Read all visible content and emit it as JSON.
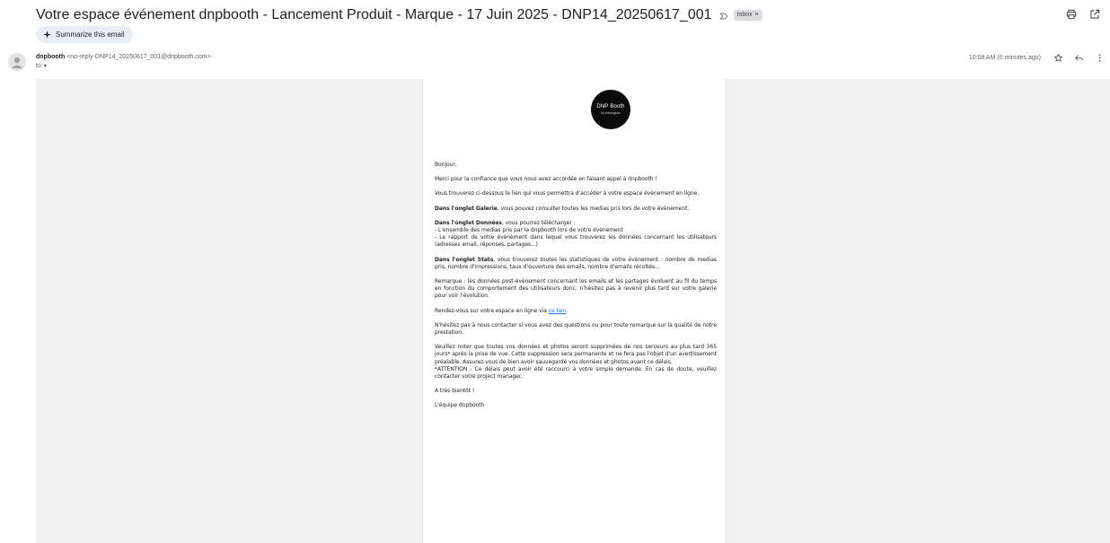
{
  "header": {
    "subject": "Votre espace événement dnpbooth - Lancement Produit - Marque - 17 Juin 2025 - DNP14_20250617_001",
    "inbox_label": "Inbox",
    "inbox_close": "×",
    "summarize_label": "Summarize this email"
  },
  "icons": {
    "importance": "label-importance-icon",
    "print": "print-icon",
    "new_window": "open-in-new-window-icon",
    "star": "star-icon",
    "reply": "reply-icon",
    "more": "more-vertical-icon",
    "sparkle": "sparkle-icon",
    "avatar": "person-icon"
  },
  "message": {
    "sender_name": "dnpbooth",
    "sender_email": "<no-reply-DNP14_20250617_001@dnpbooth.com>",
    "to_label": "to",
    "timestamp": "10:08 AM (0 minutes ago)"
  },
  "email": {
    "logo_main": "DNP",
    "logo_word": "Booth",
    "logo_sub": "by fotoringbox",
    "greeting": "Bonjour,",
    "thanks": "Merci pour la confiance que vous nous avez accordée en faisant appel à dnpbooth !",
    "intro": "Vous trouverez ci-dessous le lien qui vous permettra d'accéder à votre espace évènement en ligne.",
    "galerie_title": "Dans l'onglet Galerie",
    "galerie_text": ", vous pouvez consulter toutes les medias pris lors de votre évènement.",
    "donnees_title": "Dans l'onglet Données",
    "donnees_text": ", vous pourrez télécharger :",
    "donnees_item1": "- L'ensemble des medias pris par la dnpbooth lors de votre évènement",
    "donnees_item2": "- Le rapport de votre évènement dans lequel vous trouverez les données concernant les utilisateurs (adresses email, réponses, partages...)",
    "stats_title": "Dans l'onglet Stats",
    "stats_text": ", vous trouverez toutes les statistiques de votre évènement : nombre de medias pris, nombre d'impressions, taux d'ouverture des emails, nombre d'emails récoltés...",
    "remarque": "Remarque : les données post-évènement concernant les emails et les partages évoluent au fil du temps en fonction du comportement des utilisateurs donc, n'hésitez pas à revenir plus tard sur votre galerie pour voir l'évolution.",
    "link_prefix": "Rendez-vous sur votre espace en ligne via ",
    "link_text": "ce lien",
    "link_suffix": ".",
    "contact": "N'hésitez pas à nous contacter si vous avez des questions ou pour toute remarque sur la qualité de notre prestation.",
    "deletion_notice": "Veuillez noter que toutes vos données et photos seront supprimées de nos serveurs au plus tard 365 jours* après la prise de vue. Cette suppression sera permanente et ne fera pas l'objet d'un avertissement préalable. Assurez-vous de bien avoir sauvegardé vos données et photos avant ce délais.",
    "attention": "*ATTENTION : Ce délais peut avoir été raccourci à votre simple demande. En cas de doute, veuillez contacter votre project manager.",
    "closing": "A très bientôt !",
    "signature": "L'équipe dnpbooth"
  }
}
